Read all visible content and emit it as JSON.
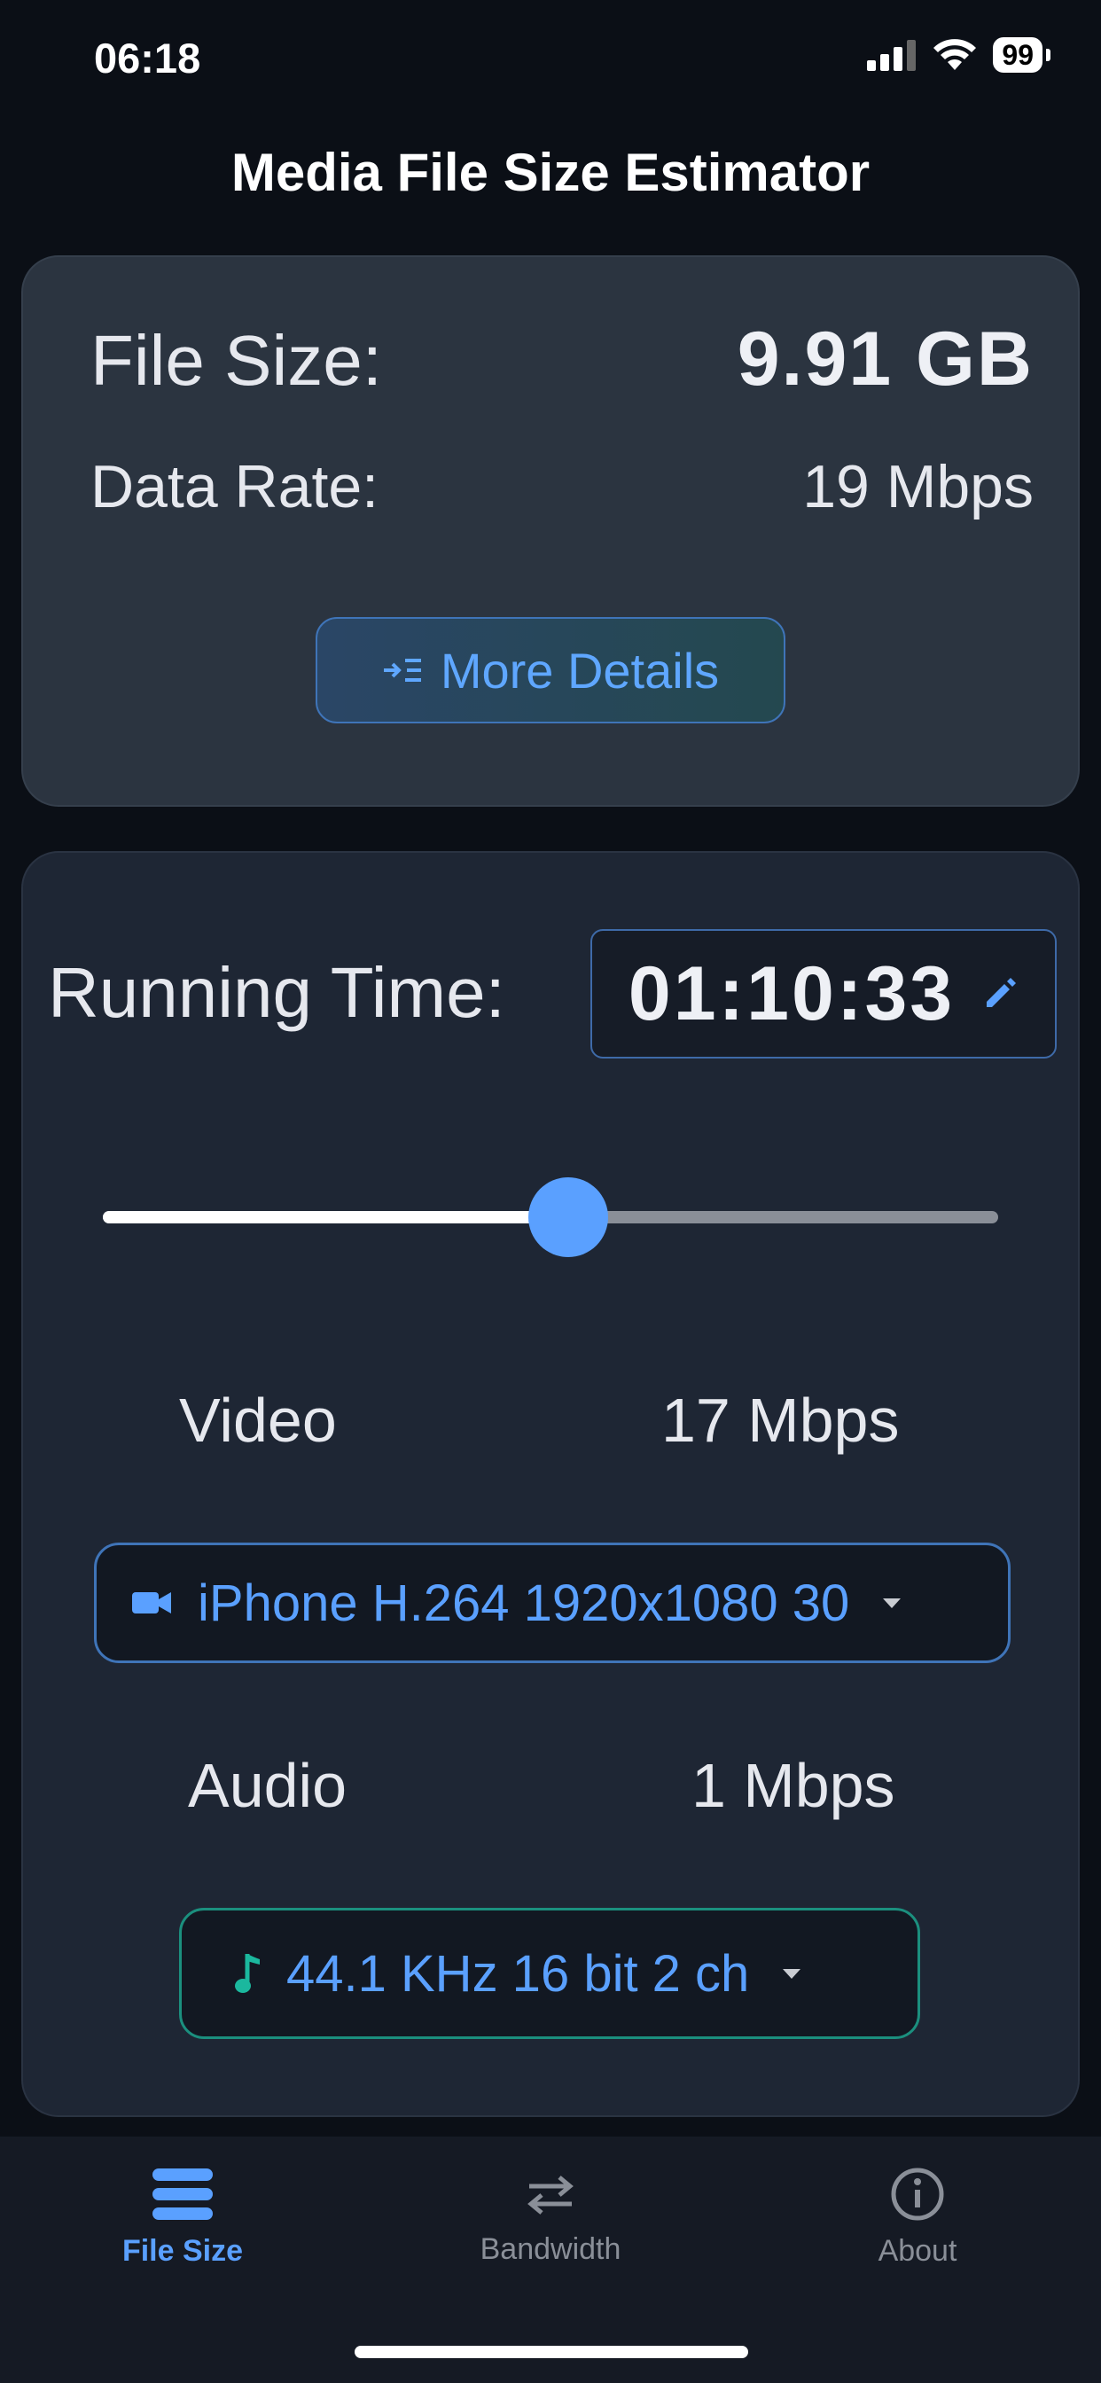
{
  "status": {
    "time": "06:18",
    "battery": "99"
  },
  "app": {
    "title": "Media File Size Estimator"
  },
  "summary": {
    "file_size_label": "File Size:",
    "file_size_value": "9.91 GB",
    "data_rate_label": "Data Rate:",
    "data_rate_value": "19 Mbps",
    "more_details_label": "More Details"
  },
  "controls": {
    "running_time_label": "Running Time:",
    "running_time_value": "01:10:33",
    "slider_fraction": 0.52,
    "video_label": "Video",
    "video_rate": "17 Mbps",
    "video_preset": "iPhone H.264 1920x1080 30",
    "audio_label": "Audio",
    "audio_rate": "1 Mbps",
    "audio_preset": "44.1 KHz 16 bit 2 ch"
  },
  "tabs": [
    {
      "label": "File Size",
      "icon": "stack-icon",
      "active": true
    },
    {
      "label": "Bandwidth",
      "icon": "swap-arrows-icon",
      "active": false
    },
    {
      "label": "About",
      "icon": "info-icon",
      "active": false
    }
  ],
  "colors": {
    "accent": "#5aa0ff",
    "audio_border": "#1b8f7e",
    "inactive_tab": "#8a8f98"
  }
}
